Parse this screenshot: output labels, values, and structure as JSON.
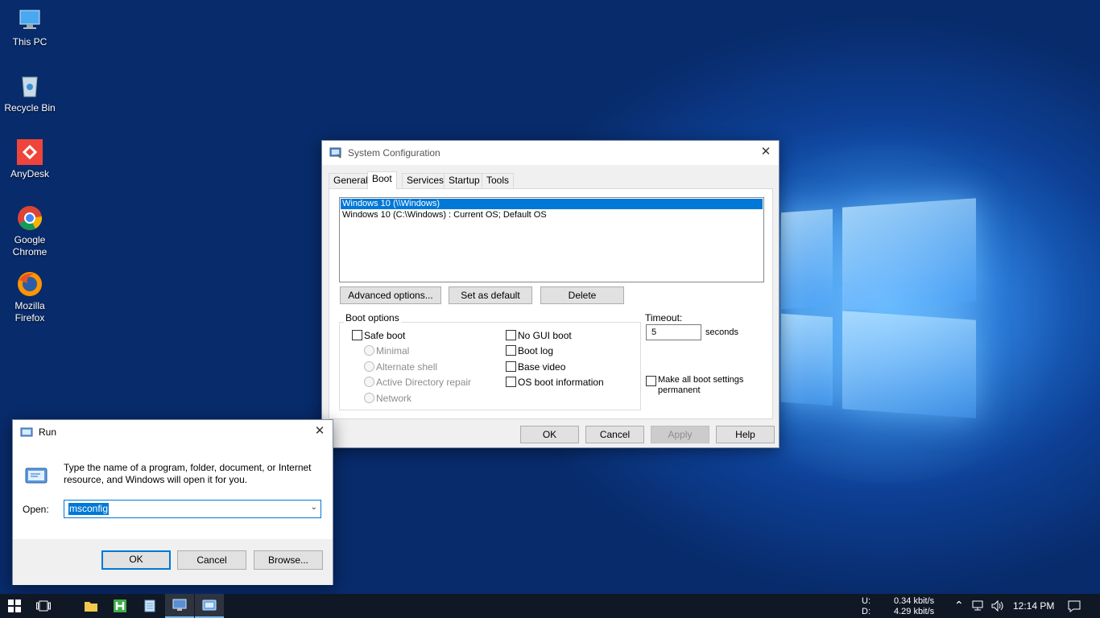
{
  "desktop": {
    "icons": [
      {
        "label": "This PC"
      },
      {
        "label": "Recycle Bin"
      },
      {
        "label": "AnyDesk"
      },
      {
        "label": "Google Chrome"
      },
      {
        "label": "Mozilla Firefox"
      }
    ]
  },
  "sysconfig": {
    "title": "System Configuration",
    "tabs": [
      "General",
      "Boot",
      "Services",
      "Startup",
      "Tools"
    ],
    "active_tab": "Boot",
    "os_list": [
      "Windows 10 (\\\\Windows)",
      "Windows 10 (C:\\Windows) : Current OS; Default OS"
    ],
    "buttons": {
      "advanced": "Advanced options...",
      "set_default": "Set as default",
      "delete": "Delete",
      "ok": "OK",
      "cancel": "Cancel",
      "apply": "Apply",
      "help": "Help"
    },
    "boot_options": {
      "group_label": "Boot options",
      "safe_boot": "Safe boot",
      "minimal": "Minimal",
      "alternate_shell": "Alternate shell",
      "ad_repair": "Active Directory repair",
      "network": "Network",
      "no_gui": "No GUI boot",
      "boot_log": "Boot log",
      "base_video": "Base video",
      "os_boot_info": "OS boot information"
    },
    "timeout": {
      "label": "Timeout:",
      "value": "5",
      "unit": "seconds"
    },
    "permanent_line1": "Make all boot settings",
    "permanent_line2": "permanent"
  },
  "run": {
    "title": "Run",
    "desc_line1": "Type the name of a program, folder, document, or Internet",
    "desc_line2": "resource, and Windows will open it for you.",
    "open_label": "Open:",
    "open_value": "msconfig",
    "buttons": {
      "ok": "OK",
      "cancel": "Cancel",
      "browse": "Browse..."
    }
  },
  "taskbar": {
    "net_up_label": "U:",
    "net_down_label": "D:",
    "net_up_value": "0.34 kbit/s",
    "net_down_value": "4.29 kbit/s",
    "clock": "12:14 PM"
  },
  "colors": {
    "accent": "#0078d7",
    "selection": "#0078d7",
    "taskbar": "#101826"
  }
}
